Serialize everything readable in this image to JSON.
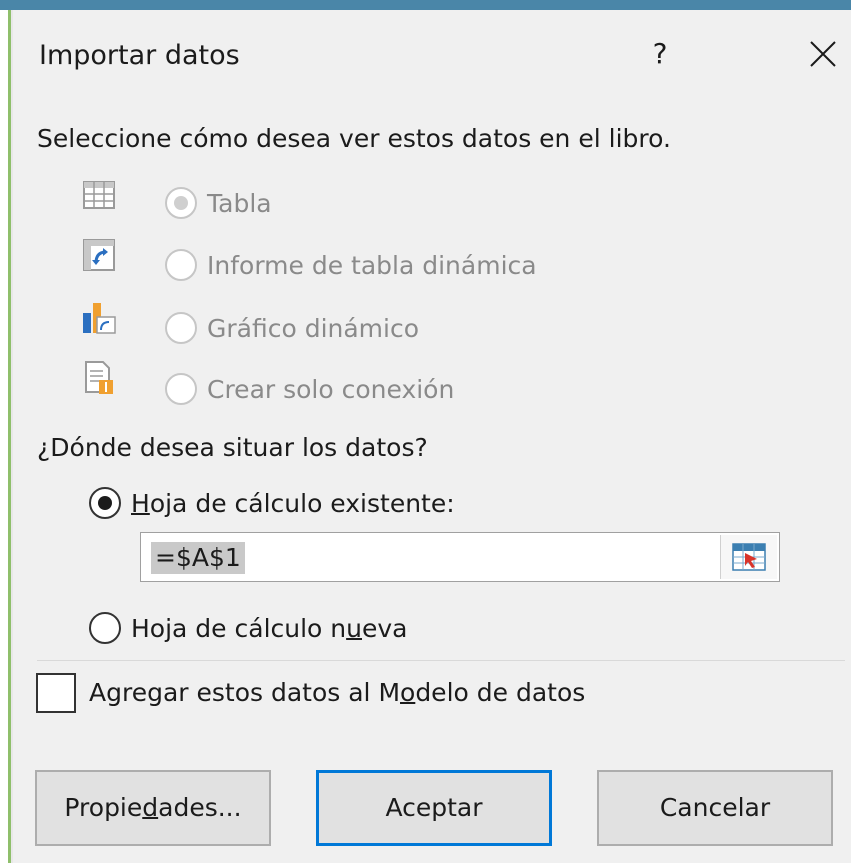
{
  "dialog": {
    "title": "Importar datos",
    "help_label": "?"
  },
  "view_section": {
    "prompt": "Seleccione cómo desea ver estos datos en el libro.",
    "options": [
      {
        "label": "Tabla",
        "icon": "table-icon",
        "selected": true,
        "enabled": false
      },
      {
        "label": "Informe de tabla dinámica",
        "icon": "pivot-table-icon",
        "selected": false,
        "enabled": false
      },
      {
        "label": "Gráfico dinámico",
        "icon": "pivot-chart-icon",
        "selected": false,
        "enabled": false
      },
      {
        "label": "Crear solo conexión",
        "icon": "connection-only-icon",
        "selected": false,
        "enabled": false
      }
    ]
  },
  "location_section": {
    "prompt": "¿Dónde desea situar los datos?",
    "existing": {
      "label_pre": "",
      "label_key": "H",
      "label_post": "oja de cálculo existente:",
      "selected": true
    },
    "reference_value": "=$A$1",
    "new_sheet": {
      "label_pre": "Hoja de cálculo n",
      "label_key": "u",
      "label_post": "eva",
      "selected": false
    }
  },
  "data_model": {
    "label_pre": "Agregar estos datos al M",
    "label_key": "o",
    "label_post": "delo de datos",
    "checked": false
  },
  "buttons": {
    "properties": {
      "pre": "Propie",
      "key": "d",
      "post": "ades..."
    },
    "accept": "Aceptar",
    "cancel": "Cancelar"
  },
  "colors": {
    "accent": "#0078d7",
    "titlebar_strip": "#4a86a8"
  }
}
